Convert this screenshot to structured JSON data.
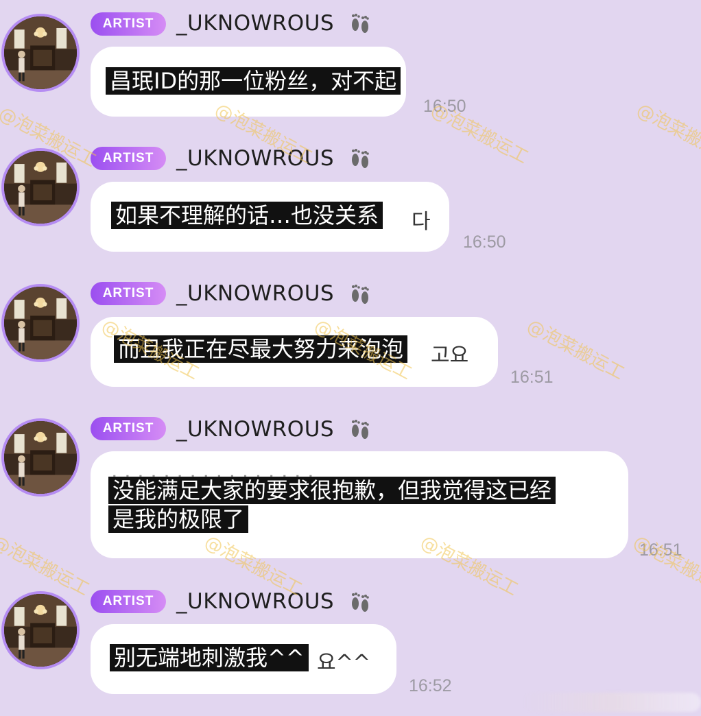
{
  "badge_label": "ARTIST",
  "username": "_UKNOWROUS",
  "username_icon": "footprints-icon",
  "avatar_icon": "profile-photo",
  "watermark": "@泡菜搬运工",
  "messages": [
    {
      "subtitle_lines": [
        "昌珉ID的那一位粉丝，对不起"
      ],
      "korean_remnant": "",
      "time": "16:50"
    },
    {
      "subtitle_lines": [
        "如果不理解的话…也没关系"
      ],
      "korean_remnant": "다",
      "time": "16:50"
    },
    {
      "subtitle_lines": [
        "而且我正在尽最大努力来泡泡"
      ],
      "korean_remnant": "고요",
      "time": "16:51"
    },
    {
      "subtitle_lines": [
        "没能满足大家的要求很抱歉，但我觉得这已经",
        "是我的极限了"
      ],
      "korean_remnant": "",
      "time": "16:51"
    },
    {
      "subtitle_lines": [
        "别无端地刺激我^^"
      ],
      "korean_remnant": "요^^",
      "time": "16:52"
    }
  ],
  "colors": {
    "background": "#e2d6f0",
    "bubble": "#ffffff",
    "badge_start": "#9b4ff0",
    "badge_end": "#d58cf5",
    "avatar_ring": "#b58cf2",
    "subtitle_bg": "#111111",
    "timestamp": "#9d9aa3",
    "watermark": "#f0c450"
  }
}
